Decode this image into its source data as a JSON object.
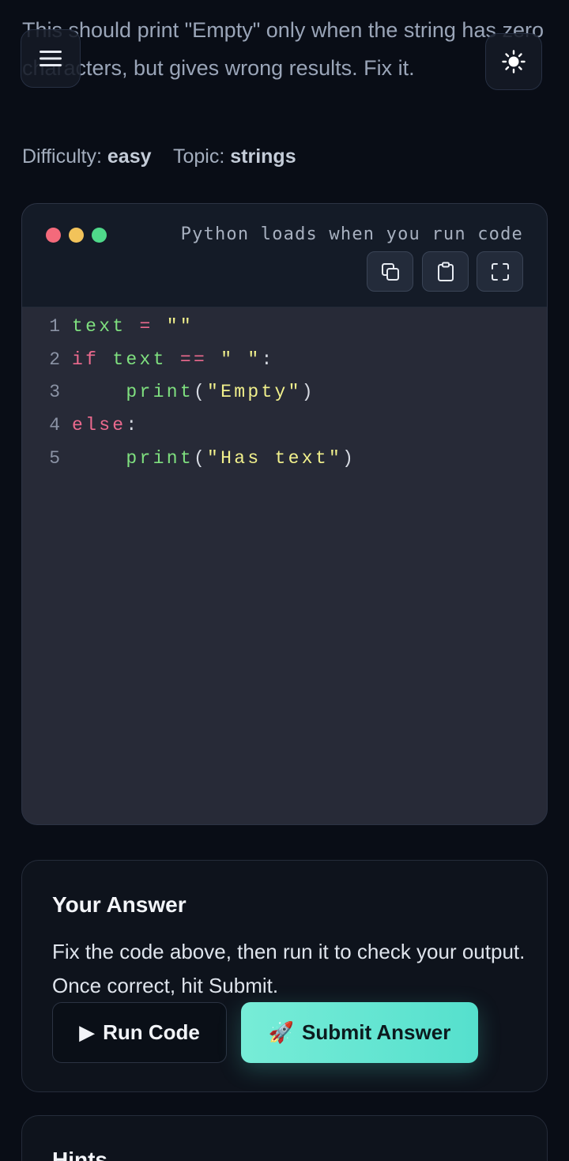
{
  "problem": {
    "description": "This should print \"Empty\" only when the string has zero characters, but gives wrong results. Fix it.",
    "difficulty_label": "Difficulty:",
    "difficulty": "easy",
    "topic_label": "Topic:",
    "topic": "strings"
  },
  "header": {
    "menu_icon": "hamburger-menu-icon",
    "theme_icon": "sun-icon"
  },
  "editor": {
    "status": "Python loads when you run code",
    "window_dots": [
      "#f46a7b",
      "#f2c35a",
      "#4fd98a"
    ],
    "tools": [
      "copy-icon",
      "clipboard-icon",
      "fullscreen-icon"
    ],
    "lines": [
      {
        "n": "1",
        "tokens": [
          [
            "var",
            "text"
          ],
          [
            "p",
            " "
          ],
          [
            "op",
            "="
          ],
          [
            "p",
            " "
          ],
          [
            "str",
            "\"\""
          ]
        ]
      },
      {
        "n": "2",
        "tokens": [
          [
            "kw",
            "if"
          ],
          [
            "p",
            " "
          ],
          [
            "var",
            "text"
          ],
          [
            "p",
            " "
          ],
          [
            "op",
            "=="
          ],
          [
            "p",
            " "
          ],
          [
            "str",
            "\" \""
          ],
          [
            "p",
            ":"
          ]
        ]
      },
      {
        "n": "3",
        "tokens": [
          [
            "p",
            "    "
          ],
          [
            "fn",
            "print"
          ],
          [
            "p",
            "("
          ],
          [
            "str",
            "\"Empty\""
          ],
          [
            "p",
            ")"
          ]
        ]
      },
      {
        "n": "4",
        "tokens": [
          [
            "kw",
            "else"
          ],
          [
            "p",
            ":"
          ]
        ]
      },
      {
        "n": "5",
        "tokens": [
          [
            "p",
            "    "
          ],
          [
            "fn",
            "print"
          ],
          [
            "p",
            "("
          ],
          [
            "str",
            "\"Has text\""
          ],
          [
            "p",
            ")"
          ]
        ]
      }
    ]
  },
  "answer": {
    "title": "Your Answer",
    "text": "Fix the code above, then run it to check your output. Once correct, hit Submit.",
    "run_icon": "▶",
    "run_label": "Run Code",
    "submit_icon": "🚀",
    "submit_label": "Submit Answer"
  },
  "hints": {
    "title": "Hints"
  },
  "colors": {
    "background": "#090d16",
    "accent": "#66e6d2",
    "editor_bg": "#272a37"
  }
}
